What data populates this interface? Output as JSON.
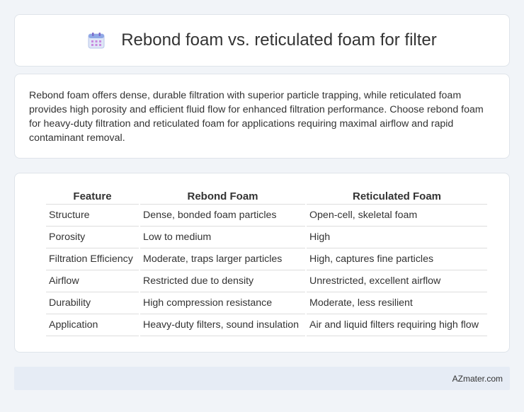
{
  "header": {
    "title": "Rebond foam vs. reticulated foam for filter",
    "icon": "calendar-icon"
  },
  "summary": {
    "text": "Rebond foam offers dense, durable filtration with superior particle trapping, while reticulated foam provides high porosity and efficient fluid flow for enhanced filtration performance. Choose rebond foam for heavy-duty filtration and reticulated foam for applications requiring maximal airflow and rapid contaminant removal."
  },
  "table": {
    "headers": [
      "Feature",
      "Rebond Foam",
      "Reticulated Foam"
    ],
    "rows": [
      [
        "Structure",
        "Dense, bonded foam particles",
        "Open-cell, skeletal foam"
      ],
      [
        "Porosity",
        "Low to medium",
        "High"
      ],
      [
        "Filtration Efficiency",
        "Moderate, traps larger particles",
        "High, captures fine particles"
      ],
      [
        "Airflow",
        "Restricted due to density",
        "Unrestricted, excellent airflow"
      ],
      [
        "Durability",
        "High compression resistance",
        "Moderate, less resilient"
      ],
      [
        "Application",
        "Heavy-duty filters, sound insulation",
        "Air and liquid filters requiring high flow"
      ]
    ]
  },
  "footer": {
    "text": "AZmater.com"
  },
  "colors": {
    "background": "#f1f4f8",
    "card": "#ffffff",
    "footer": "#e6ecf5",
    "icon_accent": "#8a6fd1"
  }
}
